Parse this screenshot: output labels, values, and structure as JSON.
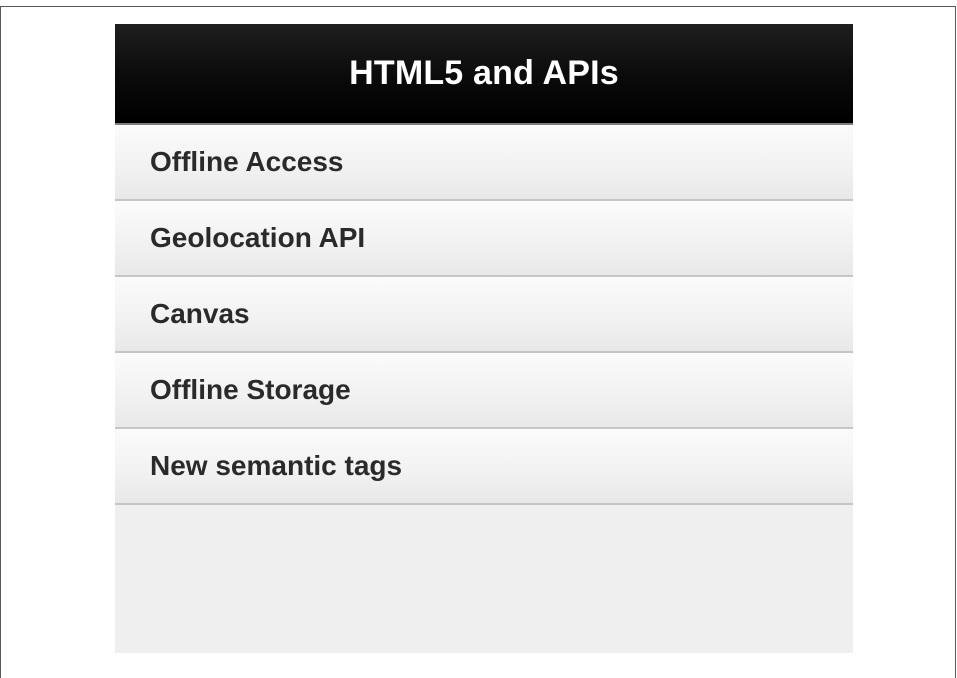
{
  "header": {
    "title": "HTML5 and APIs"
  },
  "menu": {
    "items": [
      {
        "label": "Offline Access"
      },
      {
        "label": "Geolocation API"
      },
      {
        "label": "Canvas"
      },
      {
        "label": "Offline Storage"
      },
      {
        "label": "New semantic tags"
      }
    ]
  },
  "colors": {
    "header_background": "#000000",
    "header_text": "#ffffff",
    "item_background": "#f1f1f1",
    "item_text": "#2a2a2a",
    "divider": "#c6c6c6"
  }
}
